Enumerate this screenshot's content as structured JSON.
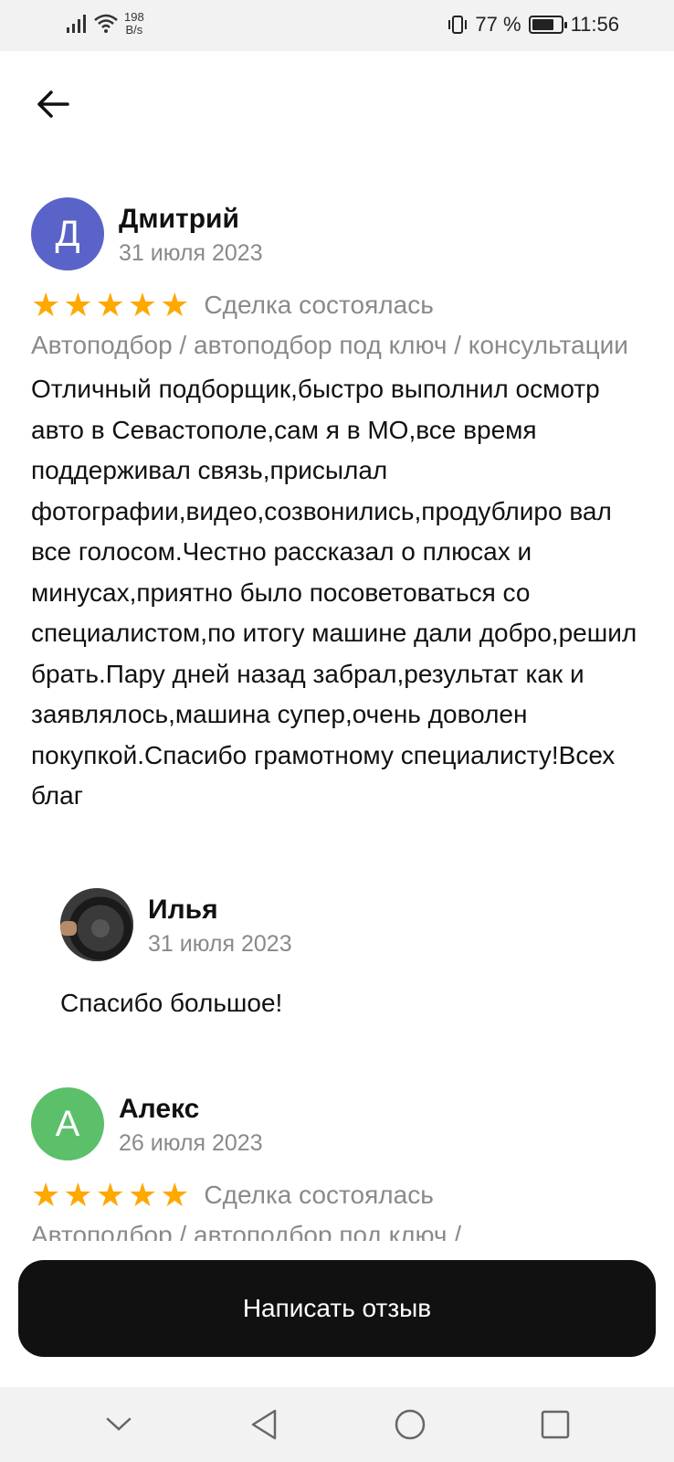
{
  "status_bar": {
    "net_speed_value": "198",
    "net_speed_unit": "B/s",
    "battery": "77 %",
    "battery_level": 0.77,
    "time": "11:56"
  },
  "icons": {
    "back": "arrow-left-icon",
    "star": "star-icon",
    "nav_down": "chevron-down-icon",
    "nav_back": "triangle-back-icon",
    "nav_home": "circle-home-icon",
    "nav_recents": "square-recents-icon"
  },
  "colors": {
    "star": "#ffa800",
    "avatar_d": "#5a63c8",
    "avatar_a": "#5cbf6a",
    "button": "#111111"
  },
  "reviews": [
    {
      "avatar_letter": "Д",
      "author": "Дмитрий",
      "date": "31 июля 2023",
      "rating": 5,
      "status": "Сделка состоялась",
      "category": "Автоподбор / автоподбор под ключ / консультации",
      "text": "Отличный подборщик,быстро выполнил осмотр авто в Севастополе,сам я в МО,все время поддерживал связь,присылал фотографии,видео,созвонились,продублиро вал все голосом.Честно рассказал о плюсах и минусах,приятно было посоветоваться со специалистом,по итогу машине дали добро,решил брать.Пару дней назад забрал,результат как и заявлялось,машина супер,очень доволен покупкой.Спасибо грамотному специалисту!Всех благ"
    },
    {
      "avatar_letter": "А",
      "author": "Алекс",
      "date": "26 июля 2023",
      "rating": 5,
      "status": "Сделка состоялась",
      "category": "Автоподбор / автоподбор под ключ /"
    }
  ],
  "reply": {
    "author": "Илья",
    "date": "31 июля 2023",
    "text": "Спасибо большое!"
  },
  "write_review_label": "Написать отзыв"
}
